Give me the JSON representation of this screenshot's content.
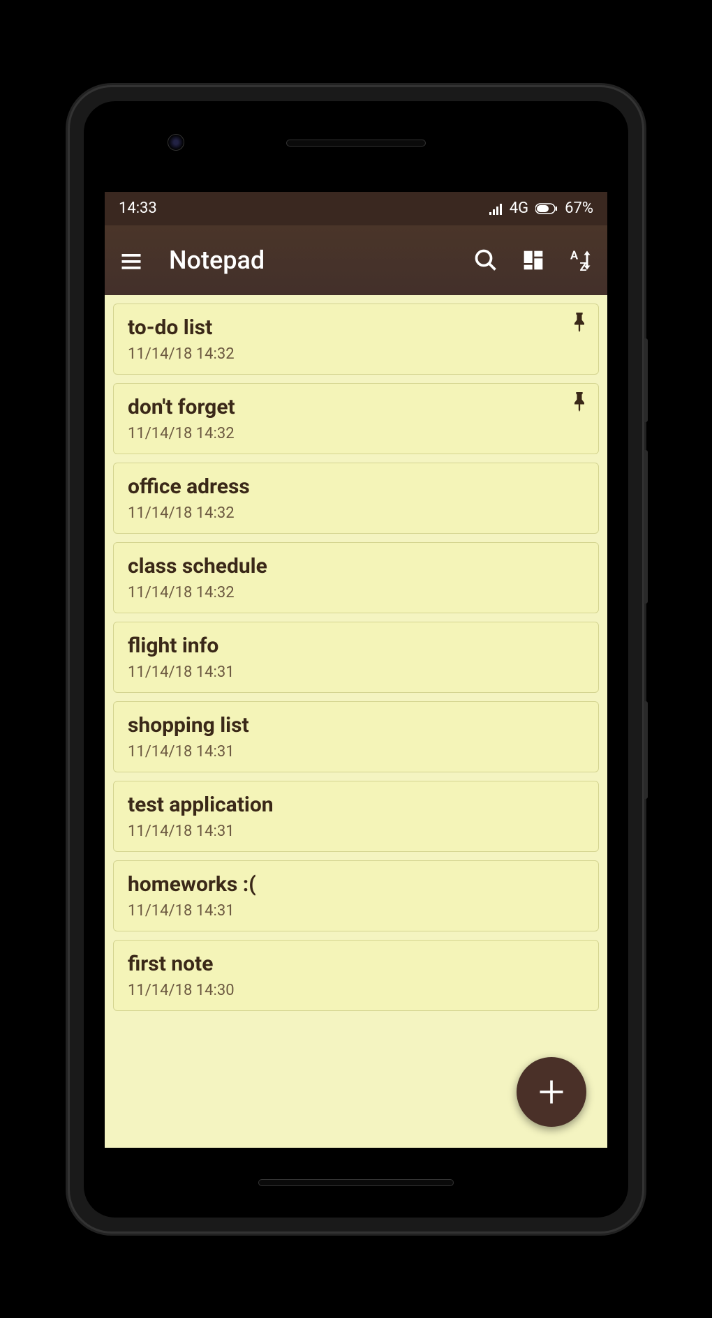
{
  "status_bar": {
    "time": "14:33",
    "network": "4G",
    "battery": "67%"
  },
  "app_bar": {
    "title": "Notepad"
  },
  "notes": [
    {
      "title": "to-do list",
      "date": "11/14/18 14:32",
      "pinned": true
    },
    {
      "title": "don't forget",
      "date": "11/14/18 14:32",
      "pinned": true
    },
    {
      "title": "office adress",
      "date": "11/14/18 14:32",
      "pinned": false
    },
    {
      "title": "class schedule",
      "date": "11/14/18 14:32",
      "pinned": false
    },
    {
      "title": "flight info",
      "date": "11/14/18 14:31",
      "pinned": false
    },
    {
      "title": "shopping list",
      "date": "11/14/18 14:31",
      "pinned": false
    },
    {
      "title": "test application",
      "date": "11/14/18 14:31",
      "pinned": false
    },
    {
      "title": "homeworks :(",
      "date": "11/14/18 14:31",
      "pinned": false
    },
    {
      "title": "first note",
      "date": "11/14/18 14:30",
      "pinned": false
    }
  ]
}
